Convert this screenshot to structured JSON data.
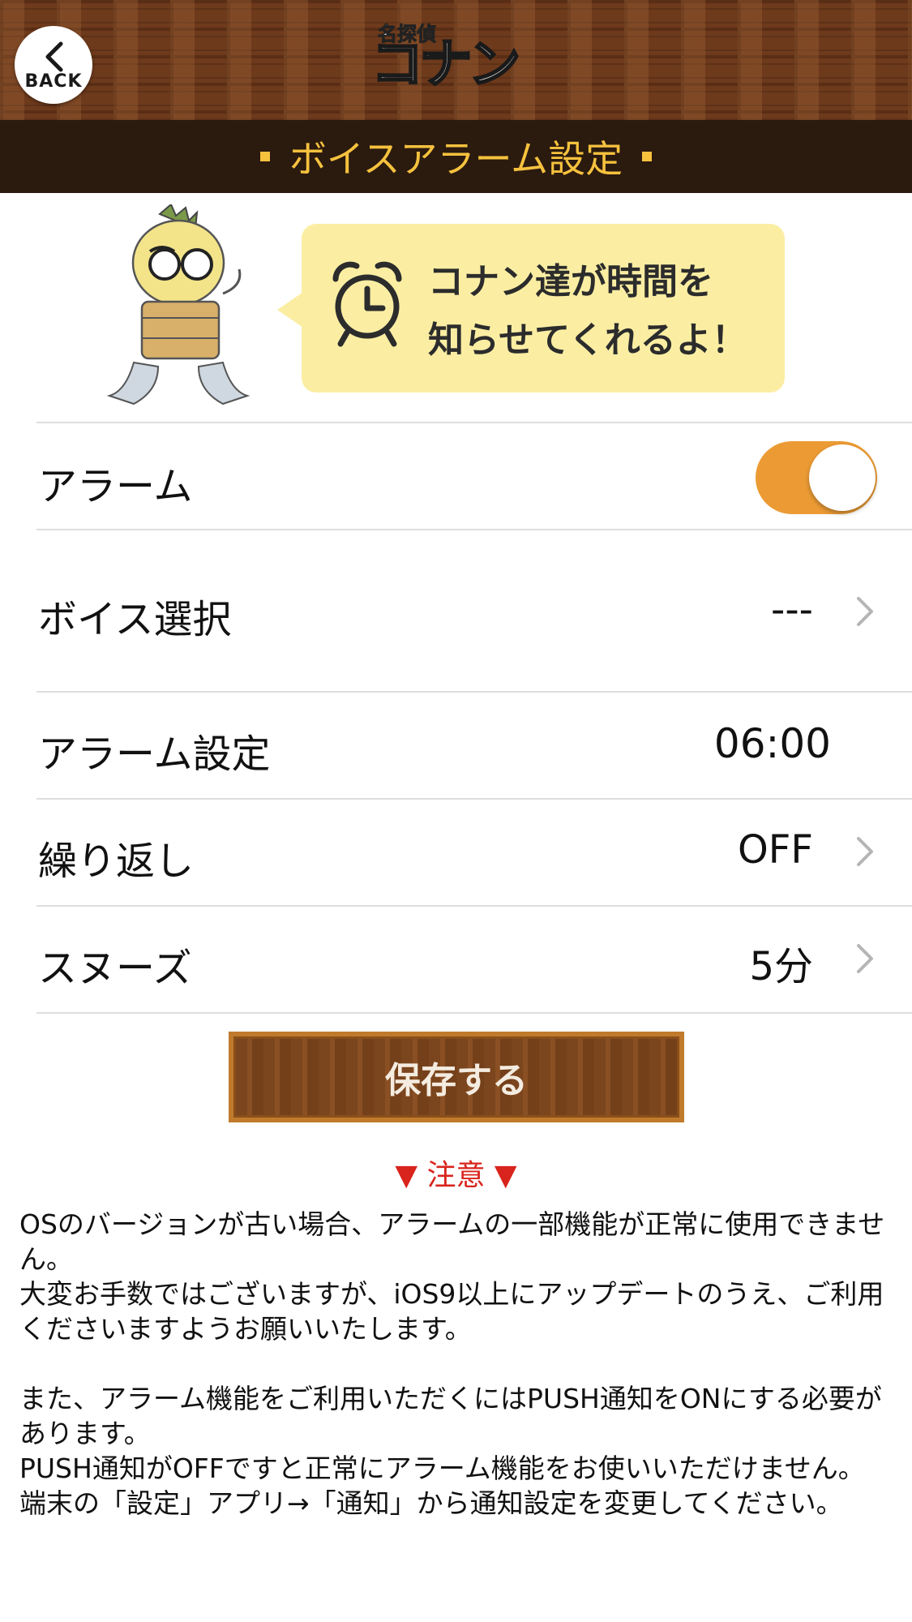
{
  "header": {
    "back_label": "BACK",
    "logo_small": "名探偵",
    "logo_main": "コナン",
    "title": "ボイスアラーム設定"
  },
  "banner": {
    "line1": "コナン達が時間を",
    "line2": "知らせてくれるよ！"
  },
  "settings": {
    "alarm": {
      "label": "アラーム",
      "enabled": true
    },
    "voice": {
      "label": "ボイス選択",
      "value": "---"
    },
    "time": {
      "label": "アラーム設定",
      "value": "06:00"
    },
    "repeat": {
      "label": "繰り返し",
      "value": "OFF"
    },
    "snooze": {
      "label": "スヌーズ",
      "value": "5分"
    }
  },
  "save_label": "保存する",
  "notice": {
    "title": "▼ 注意 ▼",
    "p1": "OSのバージョンが古い場合、アラームの一部機能が正常に使用できません。",
    "p2": "大変お手数ではございますが、iOS9以上にアップデートのうえ、ご利用くださいますようお願いいたします。",
    "p3": "また、アラーム機能をご利用いただくにはPUSH通知をONにする必要があります。",
    "p4": "PUSH通知がOFFですと正常にアラーム機能をお使いいただけません。端末の「設定」アプリ→「通知」から通知設定を変更してください。"
  },
  "colors": {
    "accent_orange": "#ec9b34",
    "title_yellow": "#f6c23e",
    "notice_red": "#d8241c",
    "header_dark": "#2b1a0e"
  }
}
